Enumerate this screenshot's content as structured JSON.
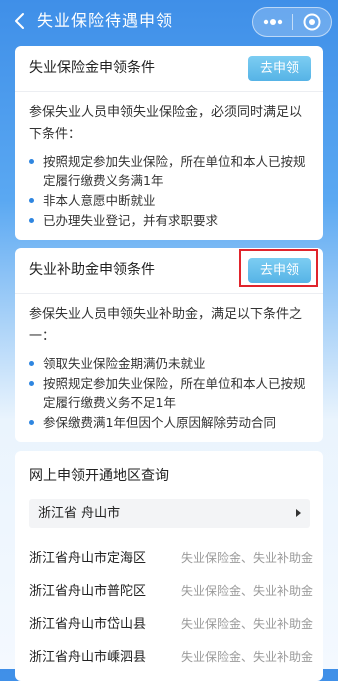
{
  "header": {
    "title": "失业保险待遇申领"
  },
  "benefit_card": {
    "title": "失业保险金申领条件",
    "apply_label": "去申领",
    "intro": "参保失业人员申领失业保险金，必须同时满足以下条件：",
    "conditions": [
      "按照规定参加失业保险，所在单位和本人已按规定履行缴费义务满1年",
      "非本人意愿中断就业",
      "已办理失业登记，并有求职要求"
    ]
  },
  "subsidy_card": {
    "title": "失业补助金申领条件",
    "apply_label": "去申领",
    "intro": "参保失业人员申领失业补助金，满足以下条件之一：",
    "conditions": [
      "领取失业保险金期满仍未就业",
      "按照规定参加失业保险，所在单位和本人已按规定履行缴费义务不足1年",
      "参保缴费满1年但因个人原因解除劳动合同"
    ]
  },
  "region_query": {
    "title": "网上申领开通地区查询",
    "selected_region": "浙江省 舟山市",
    "regions": [
      {
        "name": "浙江省舟山市定海区",
        "types": "失业保险金、失业补助金"
      },
      {
        "name": "浙江省舟山市普陀区",
        "types": "失业保险金、失业补助金"
      },
      {
        "name": "浙江省舟山市岱山县",
        "types": "失业保险金、失业补助金"
      },
      {
        "name": "浙江省舟山市嵊泗县",
        "types": "失业保险金、失业补助金"
      }
    ]
  },
  "colors": {
    "header_blue": "#3f8fe8",
    "bullet_blue": "#2f86e0",
    "apply_button": "#56b3e6",
    "highlight_red": "#e0242c"
  },
  "icons": {
    "back": "back-arrow-icon",
    "more": "more-dots-icon",
    "close": "target-circle-icon",
    "caret": "caret-right-icon"
  }
}
